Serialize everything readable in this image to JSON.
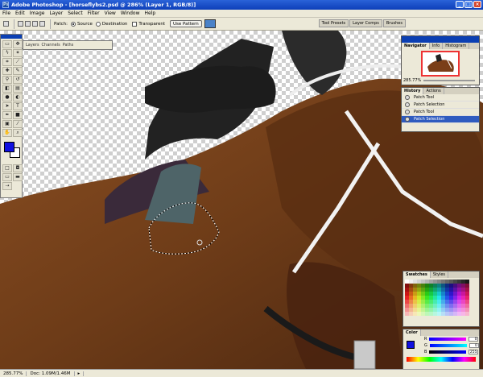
{
  "window": {
    "title": "Adobe Photoshop - [horseflybs2.psd @ 286% (Layer 1, RGB/8)]"
  },
  "menu": [
    "File",
    "Edit",
    "Image",
    "Layer",
    "Select",
    "Filter",
    "View",
    "Window",
    "Help"
  ],
  "options": {
    "patch_label": "Patch:",
    "source_label": "Source",
    "destination_label": "Destination",
    "transparent_label": "Transparent",
    "use_pattern_label": "Use Pattern"
  },
  "wells": [
    "Tool Presets",
    "Layer Comps",
    "Brushes"
  ],
  "layers_panel": {
    "tabs": [
      "Layers",
      "Channels",
      "Paths"
    ]
  },
  "navigator": {
    "tabs": [
      "Navigator",
      "Info",
      "Histogram"
    ],
    "zoom": "285.77%"
  },
  "history": {
    "tabs": [
      "History",
      "Actions"
    ],
    "items": [
      {
        "label": "Patch Tool",
        "selected": false
      },
      {
        "label": "Patch Selection",
        "selected": false
      },
      {
        "label": "Patch Tool",
        "selected": false
      },
      {
        "label": "Patch Selection",
        "selected": true
      }
    ]
  },
  "swatches": {
    "tabs": [
      "Swatches",
      "Styles"
    ]
  },
  "color_panel": {
    "tabs": [
      "Color"
    ],
    "r": {
      "label": "R",
      "value": "0"
    },
    "g": {
      "label": "G",
      "value": "0"
    },
    "b": {
      "label": "B",
      "value": "255"
    }
  },
  "status": {
    "zoom": "285.77%",
    "doc": "Doc: 1.09M/1.46M"
  },
  "colors": {
    "foreground": "#1010e0",
    "background": "#ffffff",
    "accent": "#0b3fb3"
  }
}
